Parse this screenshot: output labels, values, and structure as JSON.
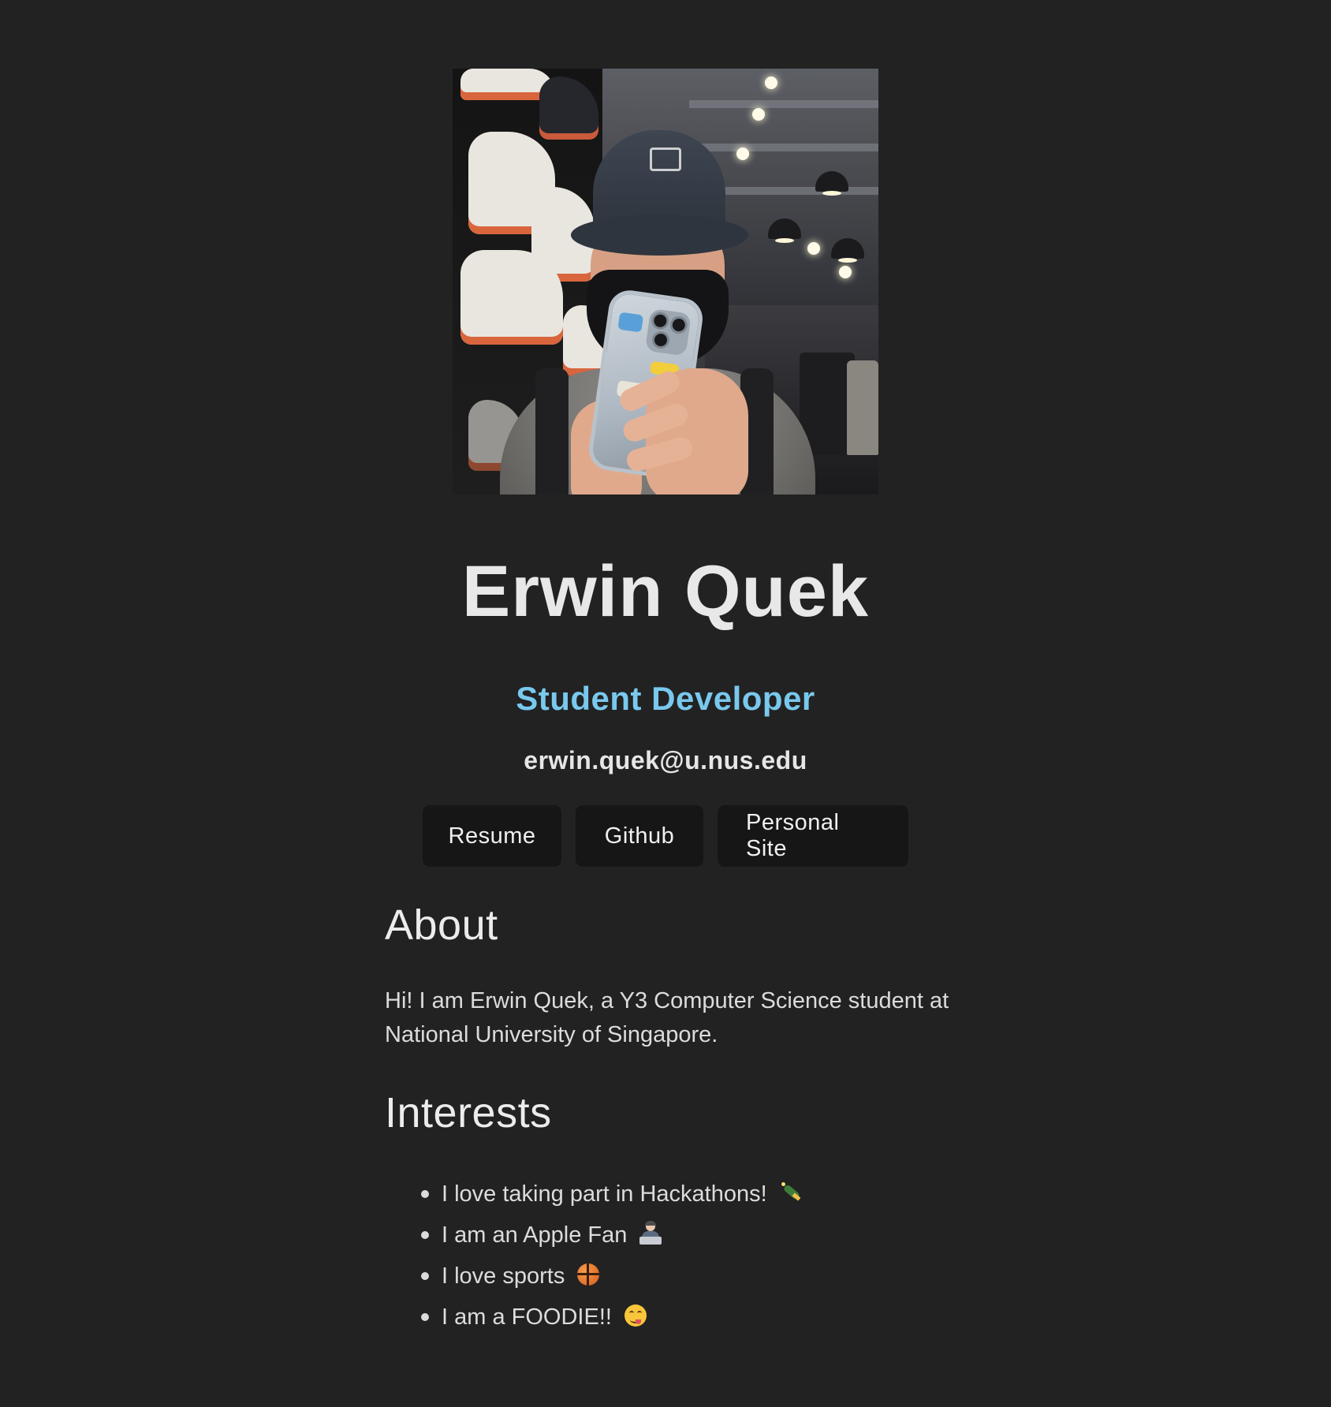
{
  "profile": {
    "name": "Erwin Quek",
    "role": "Student Developer",
    "email": "erwin.quek@u.nus.edu"
  },
  "links": {
    "resume": "Resume",
    "github": "Github",
    "personal_site": "Personal Site"
  },
  "about": {
    "heading": "About",
    "text": "Hi! I am Erwin Quek, a Y3 Computer Science student at National University of Singapore."
  },
  "interests": {
    "heading": "Interests",
    "items": [
      {
        "text": "I love taking part in Hackathons!",
        "icon": "bottle-icon"
      },
      {
        "text": "I am an Apple Fan",
        "icon": "technologist-icon"
      },
      {
        "text": "I love sports",
        "icon": "basketball-icon"
      },
      {
        "text": "I am a FOODIE!!",
        "icon": "yum-face-icon"
      }
    ]
  },
  "colors": {
    "background": "#222222",
    "accent": "#79c8ee",
    "button_bg": "#161616",
    "text": "#e6e6e6"
  }
}
